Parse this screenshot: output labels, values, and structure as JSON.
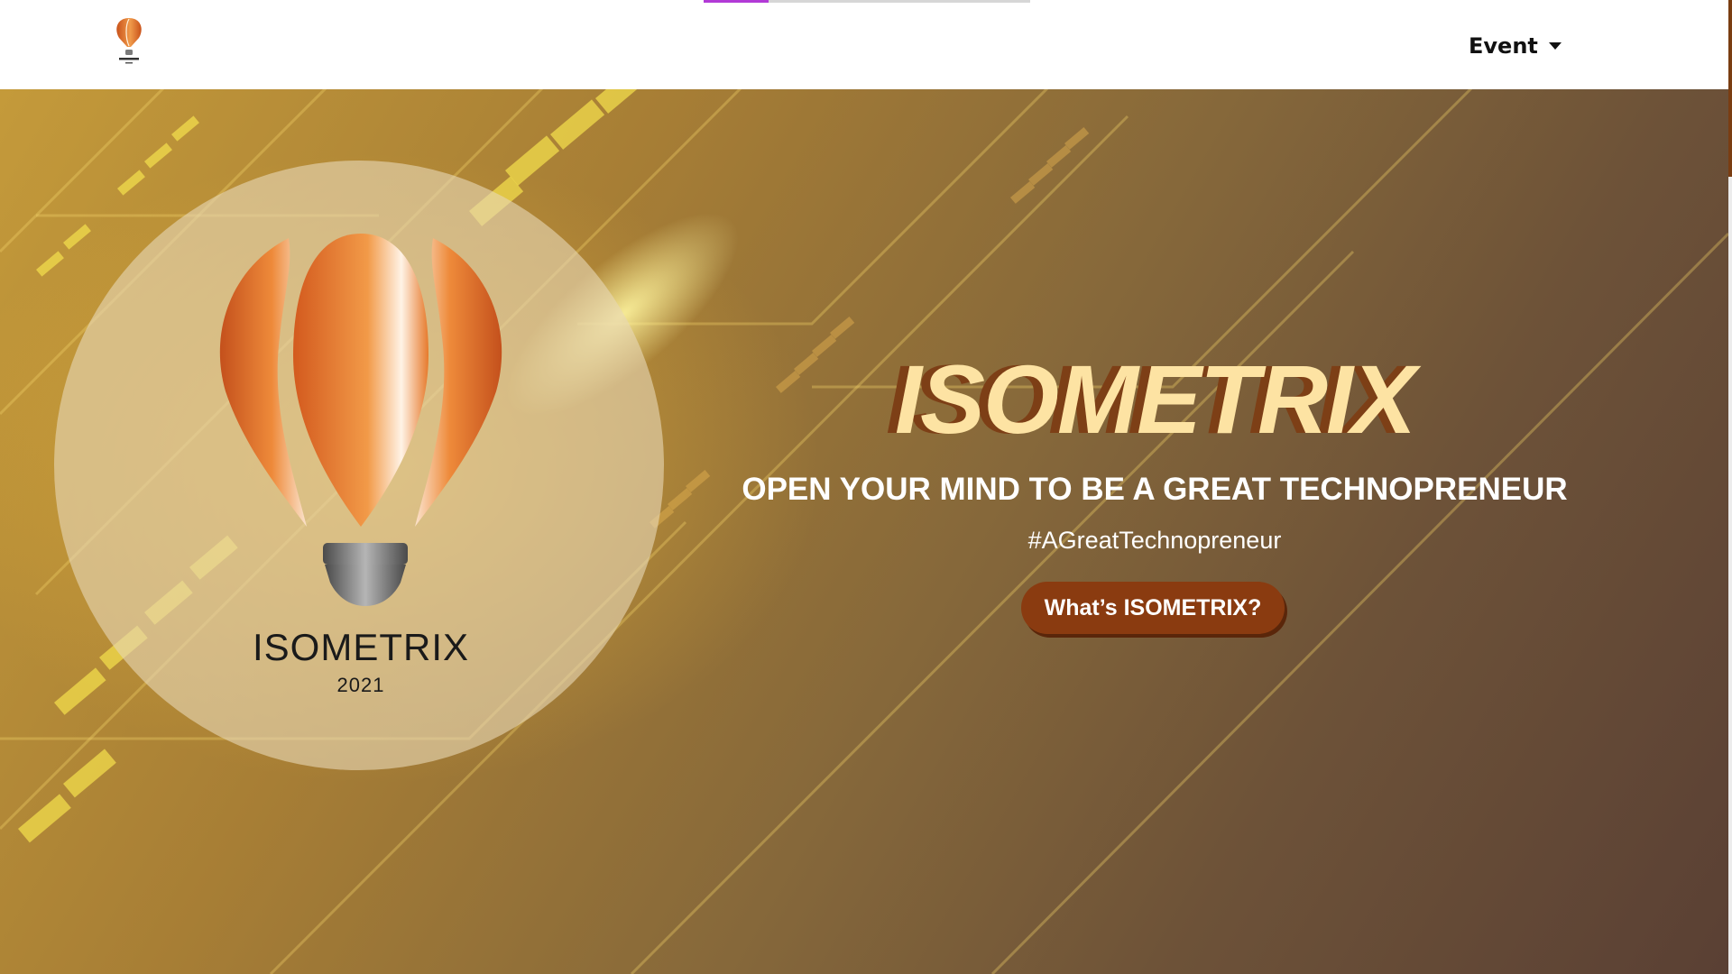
{
  "nav": {
    "menu_label": "Event",
    "scroll_progress_fraction": 0.2,
    "logo_text": "ISOMETRIX"
  },
  "hero": {
    "logo_word": "ISOMETRIX",
    "logo_year": "2021",
    "title": "ISOMETRIX",
    "subtitle": "OPEN YOUR MIND TO BE A GREAT TECHNOPRENEUR",
    "hashtag": "#AGreatTechnopreneur",
    "cta_label": "What’s ISOMETRIX?"
  },
  "colors": {
    "accent_purple": "#b23ad6",
    "cta_brown": "#8a3b10",
    "title_cream": "#fde3a3",
    "balloon_orange": "#e8762a"
  },
  "icons": {
    "nav_logo": "balloon-logo-icon",
    "menu_caret": "caret-down-icon"
  }
}
